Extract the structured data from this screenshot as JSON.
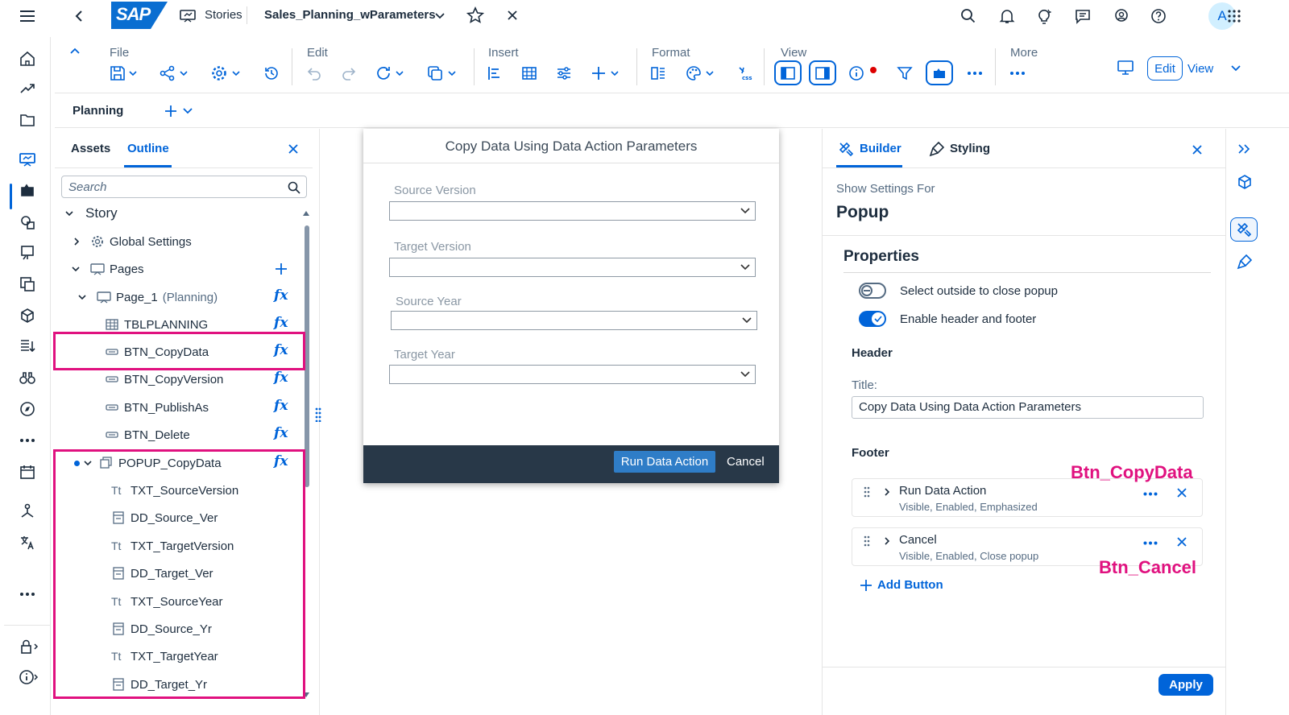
{
  "shell": {
    "logo": "SAP",
    "app_name": "Stories",
    "file_title": "Sales_Planning_wParameters",
    "avatar_initial": "A"
  },
  "toolbar": {
    "groups": {
      "file": "File",
      "edit": "Edit",
      "insert": "Insert",
      "format": "Format",
      "view": "View",
      "more": "More"
    },
    "edit_button": "Edit",
    "view_button": "View"
  },
  "planning_bar": {
    "label": "Planning"
  },
  "outline": {
    "tabs": {
      "assets": "Assets",
      "outline": "Outline"
    },
    "search_placeholder": "Search",
    "tree": {
      "story": "Story",
      "global_settings": "Global Settings",
      "pages": "Pages",
      "page_1": "Page_1",
      "page_1_suffix": "(Planning)",
      "tblplanning": "TBLPLANNING",
      "btn_copydata": "BTN_CopyData",
      "btn_copyversion": "BTN_CopyVersion",
      "btn_publishas": "BTN_PublishAs",
      "btn_delete": "BTN_Delete",
      "popup_copydata": "POPUP_CopyData",
      "txt_sourceversion": "TXT_SourceVersion",
      "dd_source_ver": "DD_Source_Ver",
      "txt_targetversion": "TXT_TargetVersion",
      "dd_target_ver": "DD_Target_Ver",
      "txt_sourceyear": "TXT_SourceYear",
      "dd_source_yr": "DD_Source_Yr",
      "txt_targetyear": "TXT_TargetYear",
      "dd_target_yr": "DD_Target_Yr"
    },
    "fx_label": "fx"
  },
  "popup": {
    "title": "Copy Data Using Data Action Parameters",
    "fields": {
      "source_version": "Source Version",
      "target_version": "Target Version",
      "source_year": "Source Year",
      "target_year": "Target Year"
    },
    "run_button": "Run Data Action",
    "cancel_button": "Cancel"
  },
  "builder": {
    "tabs": {
      "builder": "Builder",
      "styling": "Styling"
    },
    "show_settings_for": "Show Settings For",
    "object_name": "Popup",
    "properties_heading": "Properties",
    "toggles": {
      "close_outside": {
        "label": "Select outside to close popup",
        "on": false
      },
      "header_footer": {
        "label": "Enable header and footer",
        "on": true
      }
    },
    "header_heading": "Header",
    "title_label": "Title:",
    "title_value": "Copy Data Using Data Action Parameters",
    "footer_heading": "Footer",
    "footer_buttons": {
      "run": {
        "name": "Run Data Action",
        "details": "Visible, Enabled, Emphasized"
      },
      "cancel": {
        "name": "Cancel",
        "details": "Visible, Enabled, Close popup"
      }
    },
    "add_button": "Add Button",
    "apply_button": "Apply"
  },
  "annotations": {
    "btn_copydata": "Btn_CopyData",
    "btn_cancel": "Btn_Cancel"
  },
  "colors": {
    "accent": "#0064d9",
    "highlight": "#e0117f",
    "popup_footer": "#283848"
  }
}
